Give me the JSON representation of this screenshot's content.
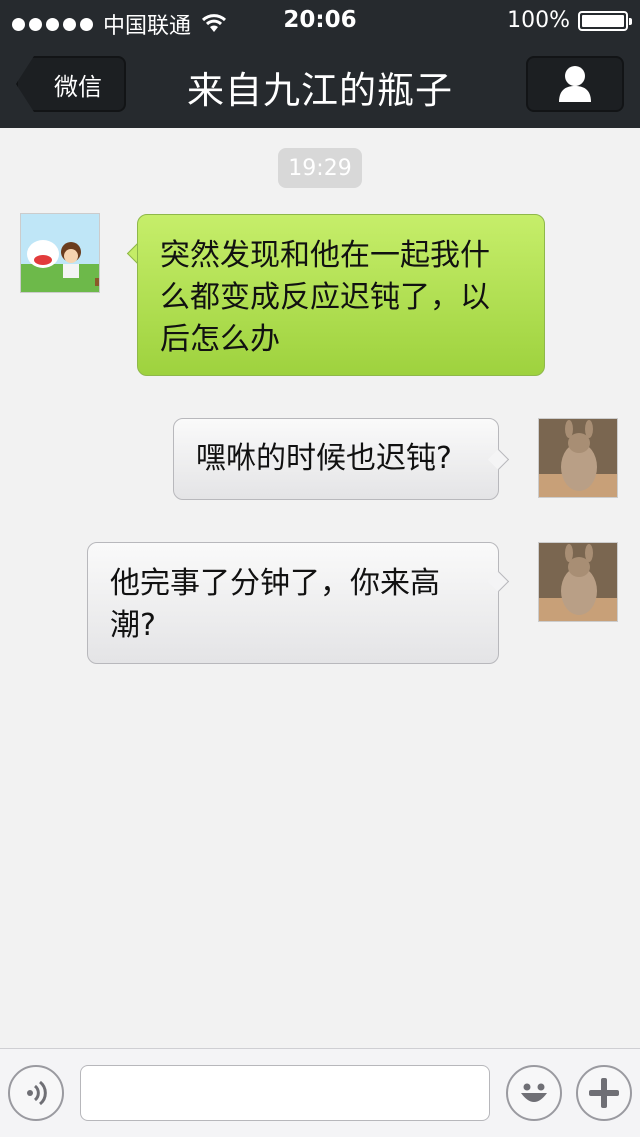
{
  "status_bar": {
    "carrier": "中国联通",
    "time": "20:06",
    "battery": "100%"
  },
  "nav": {
    "back_label": "微信",
    "title": "来自九江的瓶子",
    "profile_icon": "person-icon"
  },
  "chat": {
    "timestamp": "19:29",
    "messages": [
      {
        "side": "left",
        "text_lines": [
          "突然发现和他在一起我什",
          "么都变成反应迟钝了，以",
          "后怎么办"
        ]
      },
      {
        "side": "right",
        "text_lines": [
          "嘿咻的时候也迟钝?"
        ]
      },
      {
        "side": "right",
        "text_lines": [
          "他完事了分钟了，你来高",
          "潮?"
        ]
      }
    ]
  },
  "input_bar": {
    "voice_icon": "voice-icon",
    "emoji_icon": "emoji-icon",
    "add_icon": "plus-icon",
    "text_value": ""
  },
  "colors": {
    "nav_bg": "#262a2e",
    "sent_bubble": "#aee04f",
    "received_bubble": "#ececee",
    "chat_bg": "#f2f2f2"
  }
}
